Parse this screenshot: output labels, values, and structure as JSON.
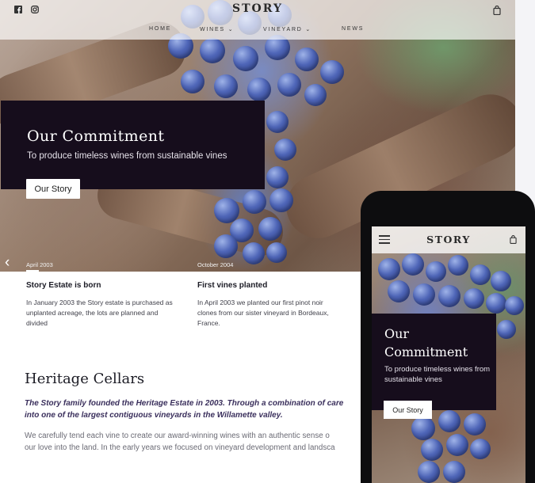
{
  "desktop": {
    "brand": "STORY",
    "nav": {
      "home": "HOME",
      "wines": "WINES",
      "vineyard": "VINEYARD",
      "news": "NEWS"
    },
    "icons": [
      "facebook-icon",
      "instagram-icon",
      "shopping-bag-icon",
      "chevron-left-icon",
      "chevron-down-icon"
    ],
    "hero": {
      "title": "Our Commitment",
      "subtitle": "To produce timeless wines from sustainable vines",
      "button": "Our Story"
    },
    "timeline": [
      {
        "date": "April 2003",
        "title": "Story Estate is born",
        "text": "In January 2003 the Story estate is purchased as unplanted acreage, the lots are planned and divided"
      },
      {
        "date": "October 2004",
        "title": "First vines planted",
        "text": "In April 2003 we planted our first pinot noir clones from our sister vineyard in Bordeaux, France."
      }
    ],
    "heritage": {
      "title": "Heritage Cellars",
      "lead_line1": "The Story family founded the Heritage Estate in 2003. Through a combination of care",
      "lead_line2": "into one of the largest contiguous vineyards in the Willamette valley.",
      "body_line1": "We carefully tend each vine to create our award-winning wines with an authentic sense o",
      "body_line2": "our love into the land. In the early years we focused on vineyard development and landsca"
    }
  },
  "mobile": {
    "brand": "STORY",
    "hero": {
      "title": "Our Commitment",
      "subtitle": "To produce timeless wines from sustainable vines",
      "button": "Our Story"
    }
  },
  "colors": {
    "dark_panel": "#160d1c",
    "lead_text": "#3a2f5c",
    "grape": "#4f66b8"
  }
}
